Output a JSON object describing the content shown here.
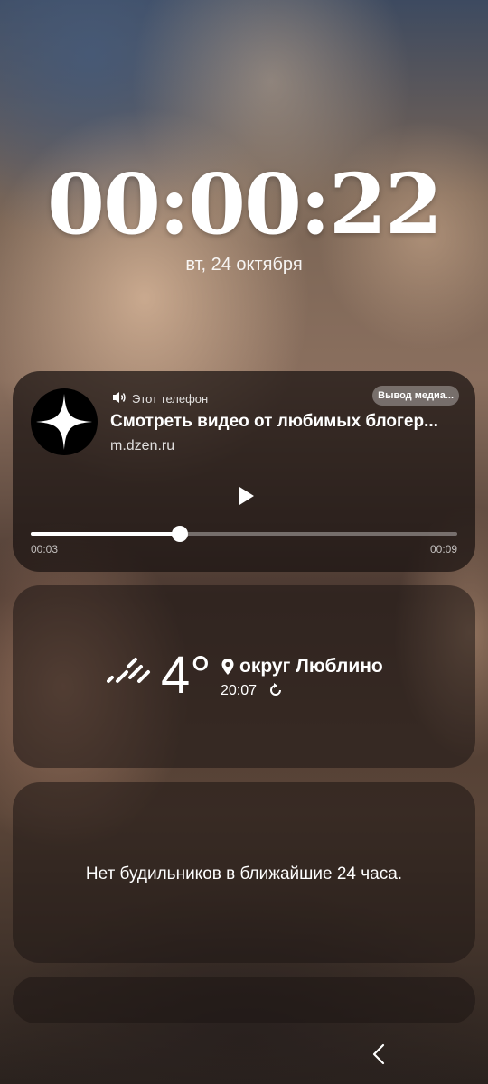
{
  "lockscreen": {
    "clock": "00:00:22",
    "date": "вт, 24 октября"
  },
  "media": {
    "icon": "zen-logo-icon",
    "device_label": "Этот телефон",
    "output_button": "Вывод медиа...",
    "title": "Смотреть видео от любимых блогер...",
    "source": "m.dzen.ru",
    "position": "00:03",
    "duration": "00:09",
    "progress_fraction": 0.35
  },
  "weather": {
    "condition_icon": "rain-icon",
    "temperature": "4°",
    "location": "округ Люблино",
    "updated_time": "20:07"
  },
  "alarms": {
    "message": "Нет будильников в ближайшие 24 часа."
  },
  "navigation": {
    "back_icon": "back-chevron-icon"
  }
}
